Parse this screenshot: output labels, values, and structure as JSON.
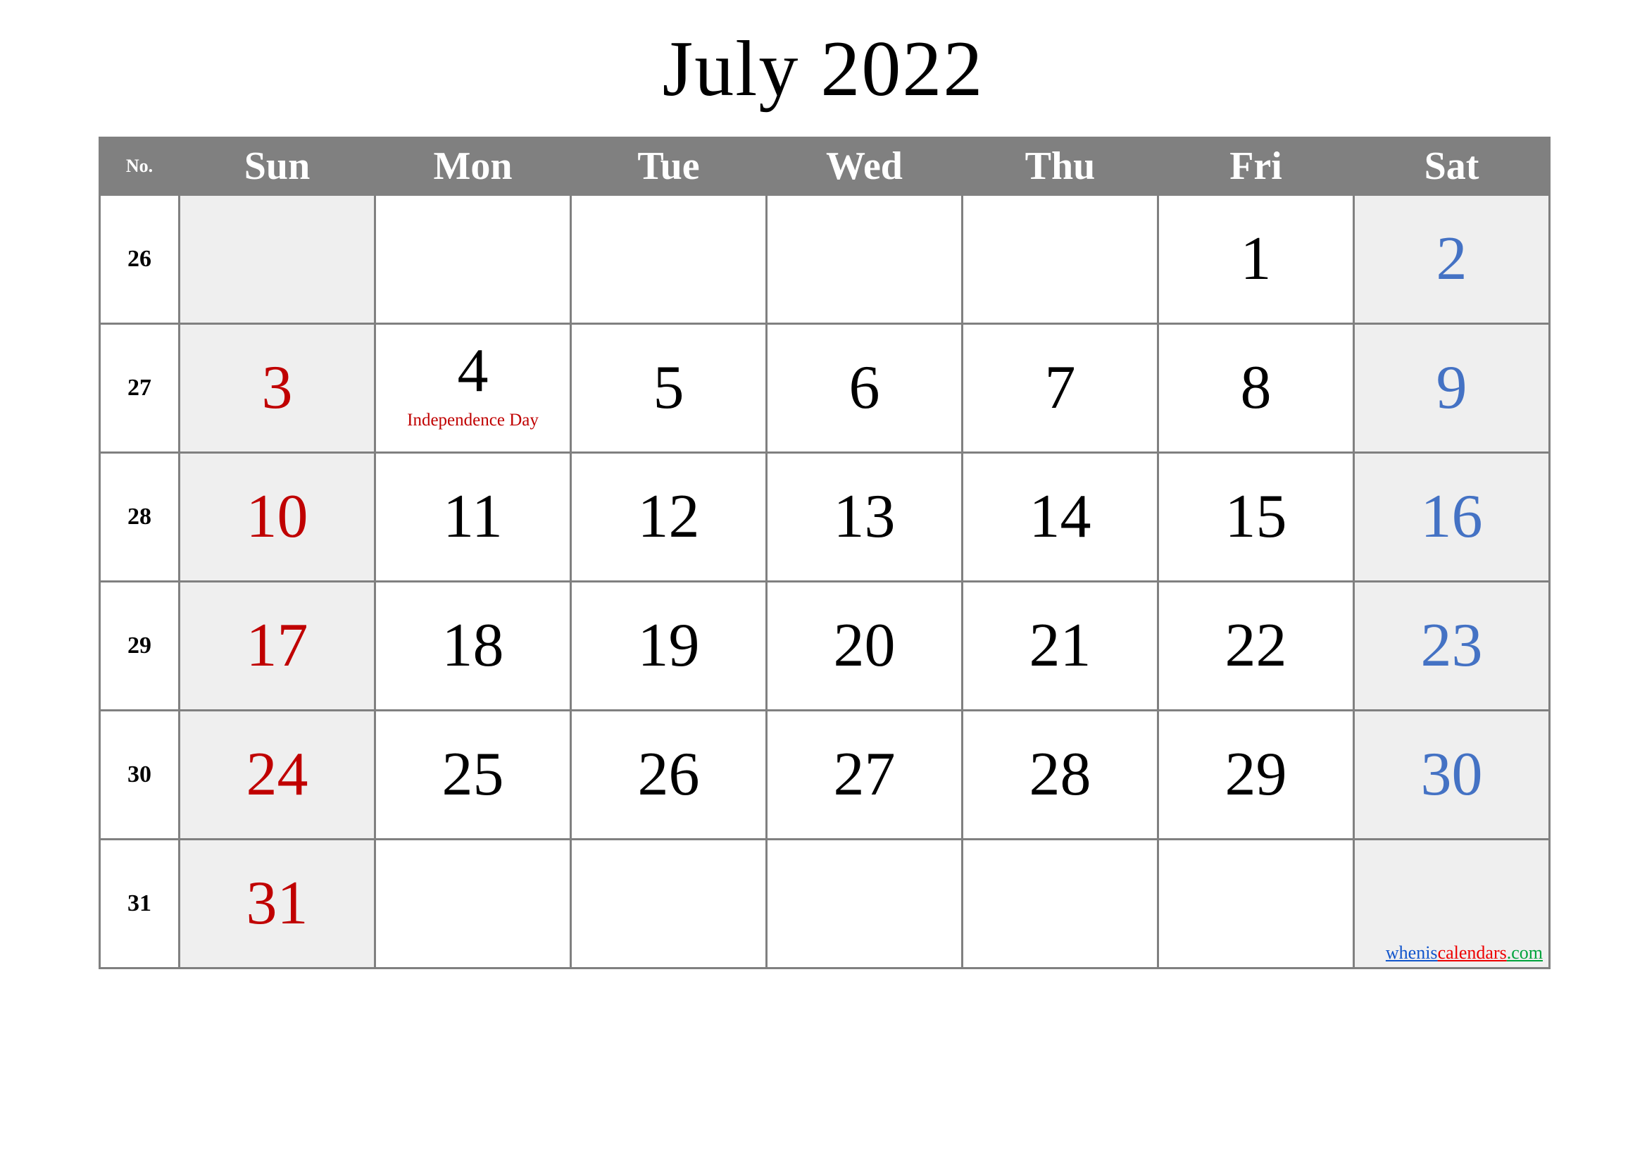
{
  "title": "July 2022",
  "header": {
    "week_no_label": "No.",
    "days": [
      "Sun",
      "Mon",
      "Tue",
      "Wed",
      "Thu",
      "Fri",
      "Sat"
    ]
  },
  "colors": {
    "header_bg": "#808080",
    "header_text": "#ffffff",
    "weekend_cell_bg": "#efefef",
    "weekday_cell_bg": "#ffffff",
    "sunday_text": "#C00000",
    "saturday_text": "#4472C4",
    "weekday_text": "#000000",
    "grid_line": "#808080",
    "event_text": "#C00000"
  },
  "weeks": [
    {
      "no": "26",
      "days": [
        {
          "date": "",
          "event": ""
        },
        {
          "date": "",
          "event": ""
        },
        {
          "date": "",
          "event": ""
        },
        {
          "date": "",
          "event": ""
        },
        {
          "date": "",
          "event": ""
        },
        {
          "date": "1",
          "event": ""
        },
        {
          "date": "2",
          "event": ""
        }
      ]
    },
    {
      "no": "27",
      "days": [
        {
          "date": "3",
          "event": ""
        },
        {
          "date": "4",
          "event": "Independence Day"
        },
        {
          "date": "5",
          "event": ""
        },
        {
          "date": "6",
          "event": ""
        },
        {
          "date": "7",
          "event": ""
        },
        {
          "date": "8",
          "event": ""
        },
        {
          "date": "9",
          "event": ""
        }
      ]
    },
    {
      "no": "28",
      "days": [
        {
          "date": "10",
          "event": ""
        },
        {
          "date": "11",
          "event": ""
        },
        {
          "date": "12",
          "event": ""
        },
        {
          "date": "13",
          "event": ""
        },
        {
          "date": "14",
          "event": ""
        },
        {
          "date": "15",
          "event": ""
        },
        {
          "date": "16",
          "event": ""
        }
      ]
    },
    {
      "no": "29",
      "days": [
        {
          "date": "17",
          "event": ""
        },
        {
          "date": "18",
          "event": ""
        },
        {
          "date": "19",
          "event": ""
        },
        {
          "date": "20",
          "event": ""
        },
        {
          "date": "21",
          "event": ""
        },
        {
          "date": "22",
          "event": ""
        },
        {
          "date": "23",
          "event": ""
        }
      ]
    },
    {
      "no": "30",
      "days": [
        {
          "date": "24",
          "event": ""
        },
        {
          "date": "25",
          "event": ""
        },
        {
          "date": "26",
          "event": ""
        },
        {
          "date": "27",
          "event": ""
        },
        {
          "date": "28",
          "event": ""
        },
        {
          "date": "29",
          "event": ""
        },
        {
          "date": "30",
          "event": ""
        }
      ]
    },
    {
      "no": "31",
      "days": [
        {
          "date": "31",
          "event": ""
        },
        {
          "date": "",
          "event": ""
        },
        {
          "date": "",
          "event": ""
        },
        {
          "date": "",
          "event": ""
        },
        {
          "date": "",
          "event": ""
        },
        {
          "date": "",
          "event": ""
        },
        {
          "date": "",
          "event": ""
        }
      ]
    }
  ],
  "watermark": {
    "part1": "whenis",
    "part2": "calendars",
    "part3": ".com"
  }
}
